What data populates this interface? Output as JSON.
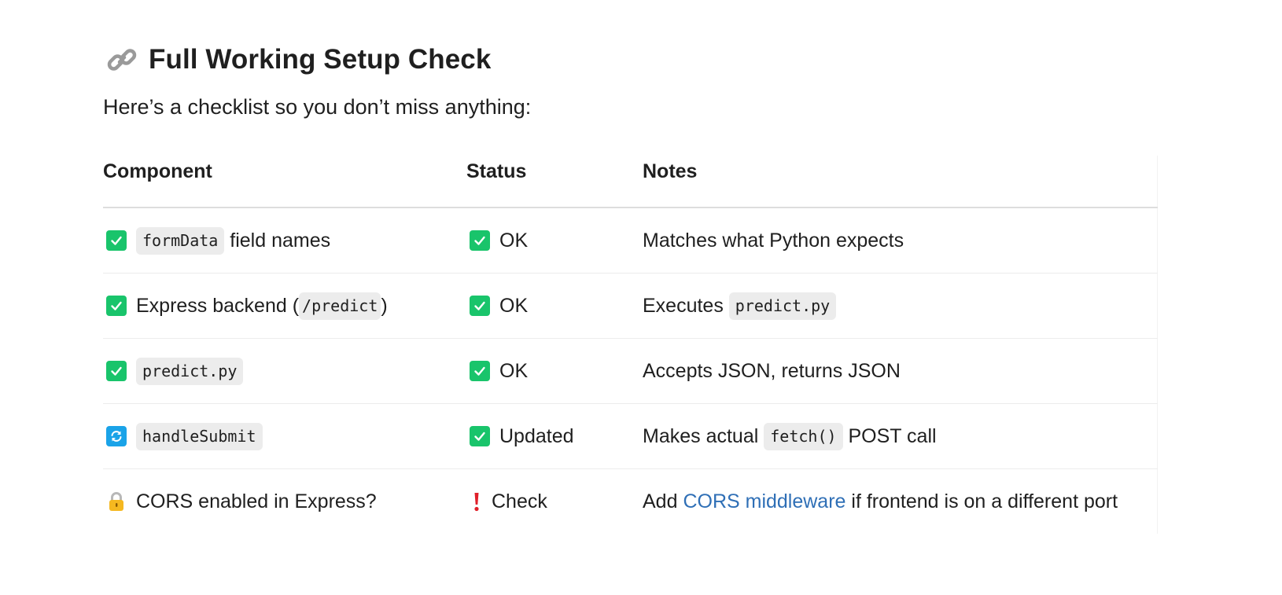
{
  "heading": {
    "icon": "link-icon",
    "title": "Full Working Setup Check"
  },
  "intro": "Here’s a checklist so you don’t miss anything:",
  "table": {
    "headers": [
      "Component",
      "Status",
      "Notes"
    ],
    "rows": [
      {
        "component_icon": "check-icon",
        "component_code": "formData",
        "component_text": " field names",
        "status_icon": "check-icon",
        "status_text": "OK",
        "notes_text": "Matches what Python expects"
      },
      {
        "component_icon": "check-icon",
        "component_prefix": "Express backend (",
        "component_code": "/predict",
        "component_suffix": ")",
        "status_icon": "check-icon",
        "status_text": "OK",
        "notes_prefix": "Executes ",
        "notes_code": "predict.py"
      },
      {
        "component_icon": "check-icon",
        "component_code": "predict.py",
        "status_icon": "check-icon",
        "status_text": "OK",
        "notes_text": "Accepts JSON, returns JSON"
      },
      {
        "component_icon": "refresh-icon",
        "component_code": "handleSubmit",
        "status_icon": "check-icon",
        "status_text": "Updated",
        "notes_prefix": "Makes actual ",
        "notes_code": "fetch()",
        "notes_suffix": " POST call"
      },
      {
        "component_icon": "lock-icon",
        "component_text": "CORS enabled in Express?",
        "status_icon": "exclamation-icon",
        "status_text": "Check",
        "notes_prefix": "Add ",
        "notes_link": "CORS middleware",
        "notes_suffix": " if frontend is on a different port"
      }
    ]
  },
  "colors": {
    "check_green": "#19c46b",
    "refresh_blue": "#1aa3e8",
    "link_blue": "#2f6fb6",
    "code_bg": "#ececec",
    "exclaim_red": "#e0202a"
  }
}
